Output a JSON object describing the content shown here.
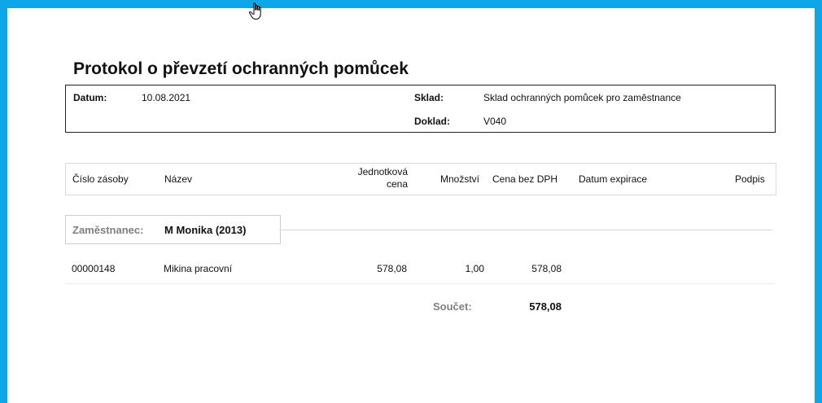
{
  "document": {
    "title": "Protokol o převzetí ochranných pomůcek",
    "info": {
      "datum_label": "Datum:",
      "datum_value": "10.08.2021",
      "sklad_label": "Sklad:",
      "sklad_value": "Sklad ochranných pomůcek pro zaměstnance",
      "doklad_label": "Doklad:",
      "doklad_value": "V040"
    },
    "columns": {
      "cislo": "Číslo zásoby",
      "nazev": "Název",
      "jednotkova_1": "Jednotková",
      "jednotkova_2": "cena",
      "mnozstvi": "Množství",
      "cena": "Cena bez DPH",
      "expirace": "Datum expirace",
      "podpis": "Podpis"
    },
    "employee": {
      "label": "Zaměstnanec:",
      "name": "M Monika (2013)"
    },
    "rows": [
      {
        "cislo": "00000148",
        "nazev": "Mikina pracovní",
        "jednotkova_cena": "578,08",
        "mnozstvi": "1,00",
        "cena": "578,08"
      }
    ],
    "total": {
      "label": "Součet:",
      "value": "578,08"
    }
  },
  "colors": {
    "frame": "#0ea5e9",
    "page": "#ffffff",
    "muted": "#808080"
  },
  "icons": {
    "cursor": "hand-cursor-icon"
  }
}
